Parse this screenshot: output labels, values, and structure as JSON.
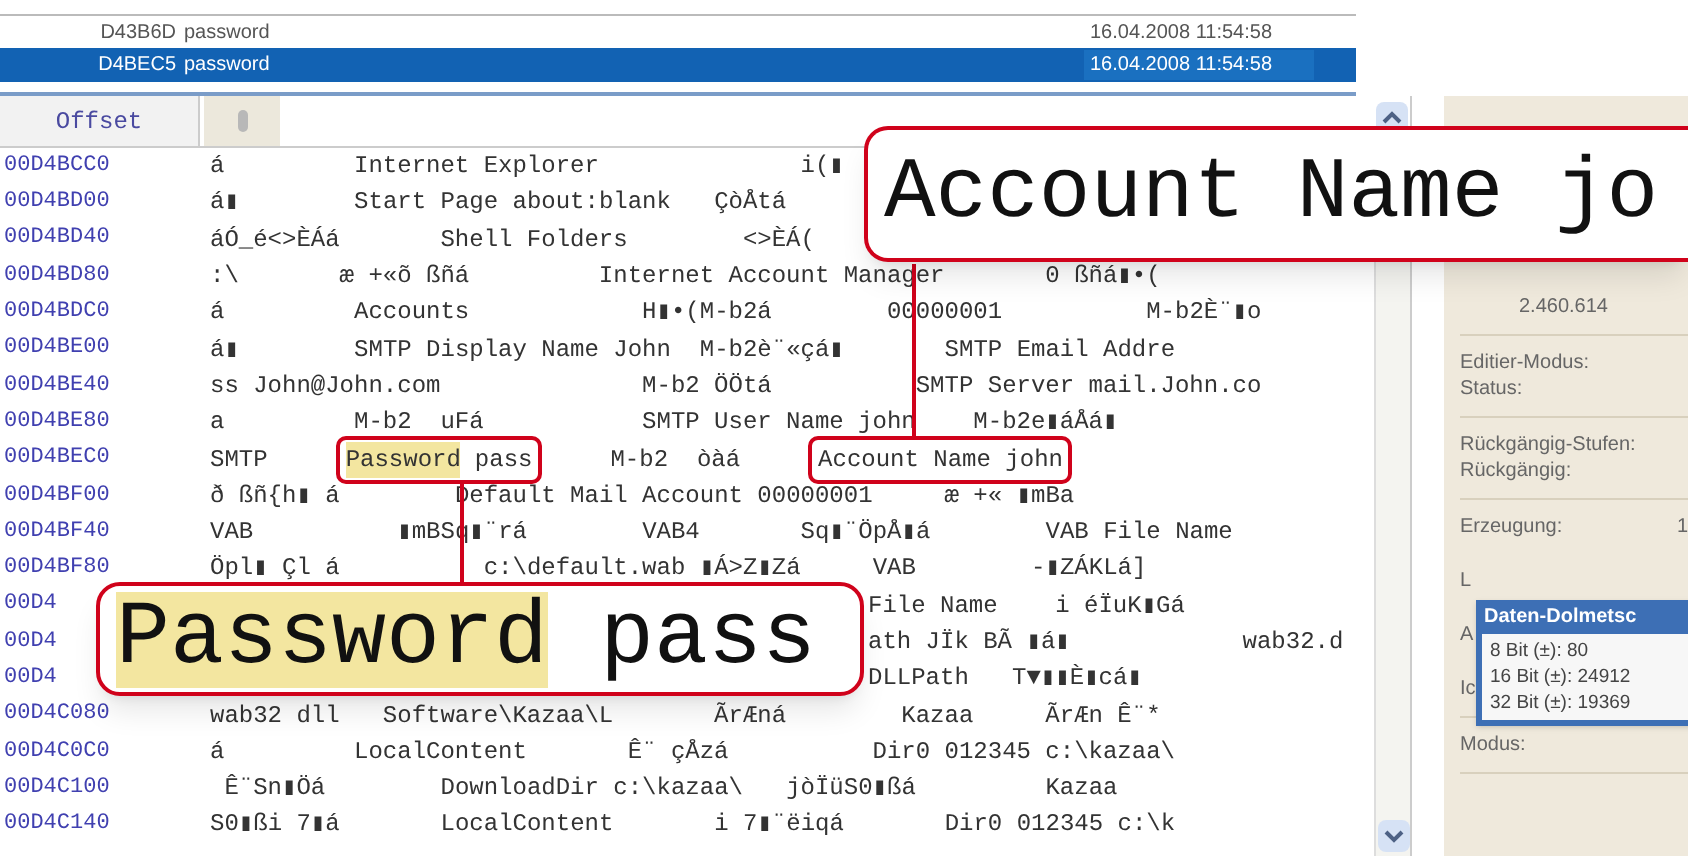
{
  "file_list": [
    {
      "offset": "D43B6D",
      "name": "password",
      "date": "16.04.2008 11:54:58",
      "selected": false
    },
    {
      "offset": "D4BEC5",
      "name": "password",
      "date": "16.04.2008 11:54:58",
      "selected": true
    }
  ],
  "hex_view": {
    "offset_header": "Offset",
    "rows": [
      {
        "kind": "plain",
        "offset": "00D4BCC0",
        "text": "á         Internet Explorer              i(▮"
      },
      {
        "kind": "plain",
        "offset": "00D4BD00",
        "text": "á▮        Start Page about:blank   ÇòÅtá"
      },
      {
        "kind": "plain",
        "offset": "00D4BD40",
        "text": "áÓ_é<>ÈÁá       Shell Folders        <>ÈÁ("
      },
      {
        "kind": "plain",
        "offset": "00D4BD80",
        "text": ":\\       æ +«õ ßñá         Internet Account Manager       0 ßñá▮•("
      },
      {
        "kind": "plain",
        "offset": "00D4BDC0",
        "text": "á         Accounts            H▮•(M-b2á        00000001          M-b2È¨▮o"
      },
      {
        "kind": "plain",
        "offset": "00D4BE00",
        "text": "á▮        SMTP Display Name John  M-b2è¨«çá▮       SMTP Email Addre"
      },
      {
        "kind": "plain",
        "offset": "00D4BE40",
        "text": "ss John@John.com              M-b2 ÖÖtá          SMTP Server mail.John.co"
      },
      {
        "kind": "plain",
        "offset": "00D4BE80",
        "text": "a         M-b2  uFá           SMTP User Name john    M-b2e▮áÅá▮"
      },
      {
        "kind": "marked",
        "offset": "00D4BEC0",
        "segments": [
          {
            "kind": "text",
            "text": "SMTP"
          },
          {
            "kind": "boxed",
            "parts": [
              {
                "text": "Password",
                "highlighted": true
              },
              {
                "text": "pass",
                "highlighted": false
              }
            ]
          },
          {
            "kind": "text",
            "text": "M-b2  òàá"
          },
          {
            "kind": "boxed",
            "parts": [
              {
                "text": "Account Name john",
                "highlighted": false
              }
            ]
          }
        ]
      },
      {
        "kind": "plain",
        "offset": "00D4BF00",
        "text": "ð ßñ{h▮ á        Default Mail Account 00000001     æ +« ▮mBa"
      },
      {
        "kind": "plain",
        "offset": "00D4BF40",
        "text": "VAB          ▮mBSq▮¨rá        VAB4       Sq▮¨ÖpÅ▮á        VAB File Name"
      },
      {
        "kind": "plain",
        "offset": "00D4BF80",
        "text": "Öpl▮ Çl á          c:\\default.wab ▮Á>Z▮Zá     VAB        -▮ZÁKLá]"
      },
      {
        "kind": "partly_hidden",
        "offset": "00D4",
        "text": "File Name    i éÏuK▮Gá"
      },
      {
        "kind": "partly_hidden",
        "offset": "00D4",
        "text": "ath JÏk BÃ ▮á▮            wab32.d"
      },
      {
        "kind": "partly_hidden",
        "offset": "00D4",
        "text": "DLLPath   T▼▮▮È▮cá▮"
      },
      {
        "kind": "plain",
        "offset": "00D4C080",
        "text": "wab32 dll   Software\\Kazaa\\L       ÃrÆná        Kazaa     ÃrÆn Ê¨*"
      },
      {
        "kind": "plain",
        "offset": "00D4C0C0",
        "text": "á         LocalContent       Ê¨ çÅzá          Dir0 012345 c:\\kazaa\\"
      },
      {
        "kind": "plain",
        "offset": "00D4C100",
        "text": " Ê¨Sn▮Öá        DownloadDir c:\\kazaa\\   jòÏüS0▮ßá         Kazaa"
      },
      {
        "kind": "plain",
        "offset": "00D4C140",
        "text": "S0▮ßi 7▮á       LocalContent       i 7▮¨ëiqá       Dir0 012345 c:\\k"
      }
    ]
  },
  "callouts": [
    {
      "parts": [
        {
          "text": "Account Name jo",
          "highlighted": false
        }
      ]
    },
    {
      "parts": [
        {
          "text": "Password",
          "highlighted": true
        },
        {
          "text": "pass",
          "highlighted": false
        }
      ]
    }
  ],
  "info_panel": {
    "groups": [
      [
        {
          "value": "2.460.614"
        }
      ],
      [
        {
          "label": "Editier-Modus:"
        },
        {
          "label": "Status:"
        }
      ],
      [
        {
          "label": "Rückgängig-Stufen:"
        },
        {
          "label": "Rückgängig:"
        }
      ],
      [
        {
          "label": "Erzeugung:",
          "value": "1"
        },
        {
          "label": "L"
        },
        {
          "label": "A"
        },
        {
          "label": "Ic"
        }
      ],
      [
        {
          "label": "Modus:"
        }
      ]
    ]
  },
  "data_interpreter": {
    "title": "Daten-Dolmetsc",
    "lines": [
      "8 Bit (±): 80",
      "16 Bit (±): 24912",
      "32 Bit (±): 19369"
    ]
  }
}
